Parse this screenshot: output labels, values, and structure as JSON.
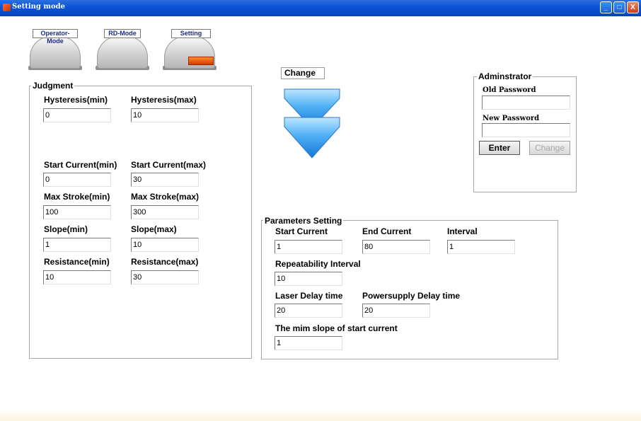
{
  "window": {
    "title": "Setting mode",
    "controls": {
      "minimize": "_",
      "maximize": "□",
      "close": "X"
    }
  },
  "modes": [
    {
      "label": "Operator-Mode",
      "active": false
    },
    {
      "label": "RD-Mode",
      "active": false
    },
    {
      "label": "Setting",
      "active": true
    }
  ],
  "judgment": {
    "title": "Judgment",
    "hysteresis_min": {
      "label": "Hysteresis(min)",
      "value": "0"
    },
    "hysteresis_max": {
      "label": "Hysteresis(max)",
      "value": "10"
    },
    "start_current_min": {
      "label": "Start Current(min)",
      "value": "0"
    },
    "start_current_max": {
      "label": "Start Current(max)",
      "value": "30"
    },
    "max_stroke_min": {
      "label": "Max Stroke(min)",
      "value": "100"
    },
    "max_stroke_max": {
      "label": "Max Stroke(max)",
      "value": "300"
    },
    "slope_min": {
      "label": "Slope(min)",
      "value": "1"
    },
    "slope_max": {
      "label": "Slope(max)",
      "value": "10"
    },
    "resistance_min": {
      "label": "Resistance(min)",
      "value": "10"
    },
    "resistance_max": {
      "label": "Resistance(max)",
      "value": "30"
    }
  },
  "change": {
    "label": "Change",
    "icon": "double-chevron-down-icon",
    "color": "#2a8fe0"
  },
  "admin": {
    "title": "Adminstrator",
    "old_password_label": "Old Password",
    "old_password_value": "",
    "new_password_label": "New Password",
    "new_password_value": "",
    "enter_label": "Enter",
    "change_label": "Change"
  },
  "parameters": {
    "title": "Parameters Setting",
    "start_current": {
      "label": "Start Current",
      "value": "1"
    },
    "end_current": {
      "label": "End Current",
      "value": "80"
    },
    "interval": {
      "label": "Interval",
      "value": "1"
    },
    "repeatability_interval": {
      "label": "Repeatability Interval",
      "value": "10"
    },
    "laser_delay": {
      "label": "Laser Delay time",
      "value": "20"
    },
    "powersupply_delay": {
      "label": "Powersupply Delay time",
      "value": "20"
    },
    "min_slope": {
      "label": "The mim slope of start current",
      "value": "1"
    }
  }
}
